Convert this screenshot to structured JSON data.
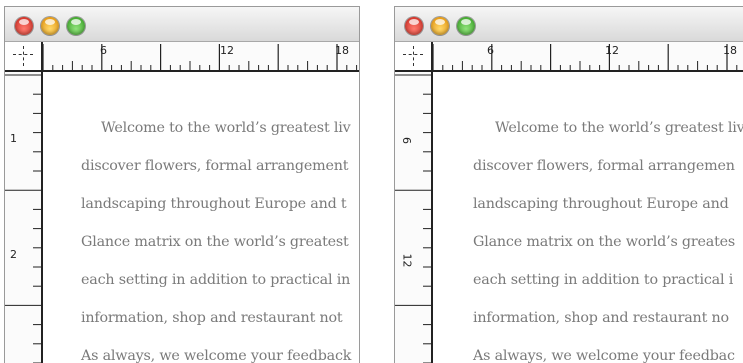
{
  "windows": [
    {
      "id": "left",
      "hruler_labels": [
        "6",
        "12",
        "18"
      ],
      "vruler_labels": [
        "1",
        "2"
      ],
      "lines": [
        "Welcome to the world’s greatest liv",
        "discover flowers, formal arrangement",
        "landscaping throughout Europe and t",
        "Glance matrix on the world’s greatest",
        "each setting in addition to practical in",
        "information, shop and restaurant not",
        "As always, we welcome your feedback"
      ]
    },
    {
      "id": "right",
      "hruler_labels": [
        "6",
        "12",
        "18"
      ],
      "vruler_labels": [
        "6",
        "12"
      ],
      "lines": [
        "Welcome to the world’s greatest liv",
        "discover flowers, formal arrangemen",
        "landscaping throughout Europe and",
        "Glance matrix on the world’s greates",
        "each setting in addition to practical i",
        "information, shop and restaurant no",
        "As always, we welcome your feedbac"
      ]
    }
  ],
  "colors": {
    "text": "#7a7a7a",
    "close": "#d9342a",
    "minimize": "#f0a020",
    "zoom": "#45b02e"
  },
  "icons": [
    "close-button-icon",
    "minimize-button-icon",
    "zoom-button-icon",
    "ruler-origin-icon"
  ]
}
